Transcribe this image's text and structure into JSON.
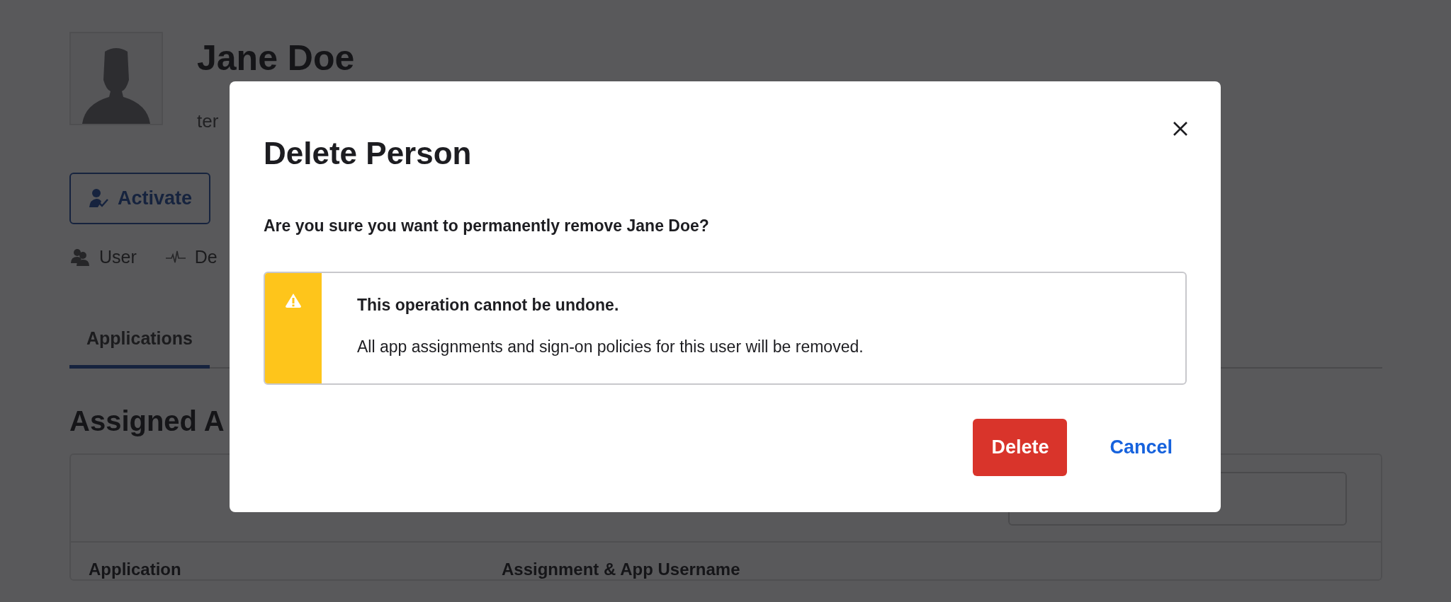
{
  "page": {
    "name": "Jane Doe",
    "subtitle": "ter",
    "actions": [
      {
        "label": "Activate"
      }
    ],
    "meta": [
      {
        "kind": "user",
        "label": "User"
      },
      {
        "kind": "activity",
        "label": "De"
      }
    ],
    "tabs": [
      {
        "label": "Applications",
        "selected": true
      }
    ],
    "section_title": "Assigned A",
    "table": {
      "columns": [
        "Application",
        "Assignment & App Username"
      ]
    }
  },
  "dialog": {
    "title": "Delete Person",
    "question": "Are you sure you want to permanently remove Jane Doe?",
    "alert": {
      "title": "This operation cannot be undone.",
      "body": "All app assignments and sign-on policies for this user will be removed."
    },
    "buttons": [
      {
        "kind": "danger",
        "label": "Delete"
      },
      {
        "kind": "link",
        "label": "Cancel"
      }
    ]
  }
}
